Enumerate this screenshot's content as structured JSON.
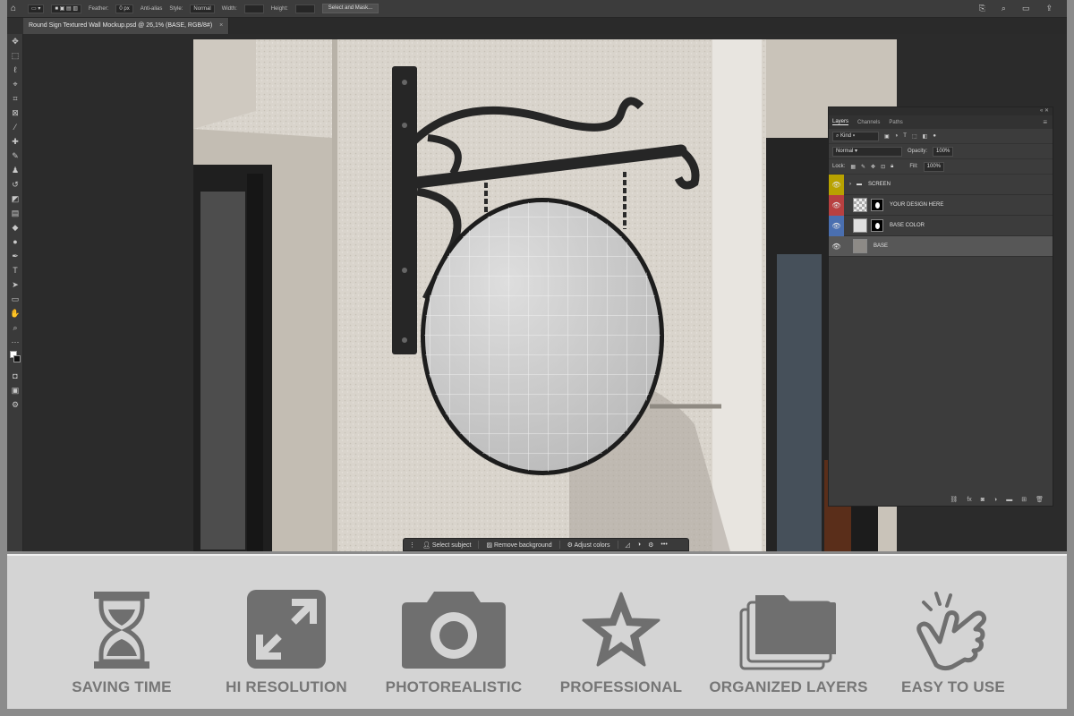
{
  "options_bar": {
    "feather_label": "Feather:",
    "feather_value": "0 px",
    "anti_alias_label": "Anti-alias",
    "style_label": "Style:",
    "style_value": "Normal",
    "width_label": "Width:",
    "height_label": "Height:",
    "select_mask_label": "Select and Mask..."
  },
  "document_tab": {
    "title": "Round Sign Textured Wall Mockup.psd @ 26,1% (BASE, RGB/8#)",
    "close": "×"
  },
  "contextual_taskbar": {
    "select_subject": "Select subject",
    "remove_background": "Remove background",
    "adjust_colors": "Adjust colors",
    "more": "•••"
  },
  "layers_panel": {
    "tabs": [
      "Layers",
      "Channels",
      "Paths"
    ],
    "kind_filter": "Kind",
    "blend_mode": "Normal",
    "opacity_label": "Opacity:",
    "opacity_value": "100%",
    "lock_label": "Lock:",
    "fill_label": "Fill:",
    "fill_value": "100%",
    "layers": [
      {
        "name": "SCREEN",
        "color": "#b8a200",
        "type": "group"
      },
      {
        "name": "YOUR DESIGN HERE",
        "color": "#b84040",
        "type": "smart"
      },
      {
        "name": "BASE COLOR",
        "color": "#4a6fb0",
        "type": "fill"
      },
      {
        "name": "BASE",
        "color": "",
        "type": "image",
        "selected": true
      }
    ]
  },
  "features": [
    {
      "label": "SAVING TIME",
      "icon": "hourglass-icon"
    },
    {
      "label": "HI RESOLUTION",
      "icon": "expand-arrows-icon"
    },
    {
      "label": "PHOTOREALISTIC",
      "icon": "camera-icon"
    },
    {
      "label": "PROFESSIONAL",
      "icon": "star-icon"
    },
    {
      "label": "ORGANIZED LAYERS",
      "icon": "layers-folder-icon"
    },
    {
      "label": "EASY TO USE",
      "icon": "pointing-hand-icon"
    }
  ],
  "colors": {
    "feature_icon": "#6f6f6f",
    "feature_bg": "#d4d4d4",
    "ps_panel": "#3c3c3c"
  }
}
